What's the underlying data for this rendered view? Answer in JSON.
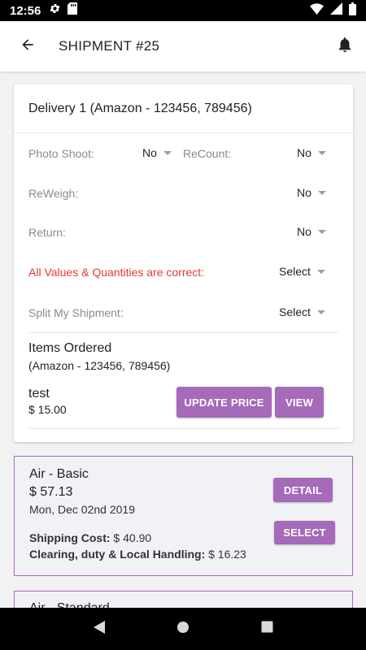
{
  "status_bar": {
    "time": "12:56"
  },
  "app_bar": {
    "title": "SHIPMENT #25"
  },
  "delivery": {
    "header": "Delivery 1 (Amazon - 123456, 789456)",
    "photo_shoot": {
      "label": "Photo Shoot:",
      "value": "No"
    },
    "recount": {
      "label": "ReCount:",
      "value": "No"
    },
    "reweigh": {
      "label": "ReWeigh:",
      "value": "No"
    },
    "return": {
      "label": "Return:",
      "value": "No"
    },
    "values_correct": {
      "label": "All Values & Quantities are correct:",
      "value": "Select"
    },
    "split": {
      "label": "Split My Shipment:",
      "value": "Select"
    },
    "items_title": "Items Ordered",
    "items_sub": "(Amazon - 123456, 789456)",
    "item": {
      "name": "test",
      "price": "$ 15.00"
    },
    "update_price_label": "UPDATE PRICE",
    "view_label": "VIEW"
  },
  "shipping_options": [
    {
      "name": "Air - Basic",
      "price": "$ 57.13",
      "date": "Mon, Dec 02nd 2019",
      "shipping_cost_label": "Shipping Cost:",
      "shipping_cost": " $ 40.90",
      "clearing_label": "Clearing, duty & Local Handling:",
      "clearing": " $ 16.23",
      "detail_label": "DETAIL",
      "select_label": "SELECT"
    },
    {
      "name": "Air - Standard"
    }
  ],
  "colors": {
    "accent": "#a56ab9",
    "error": "#e53935"
  }
}
